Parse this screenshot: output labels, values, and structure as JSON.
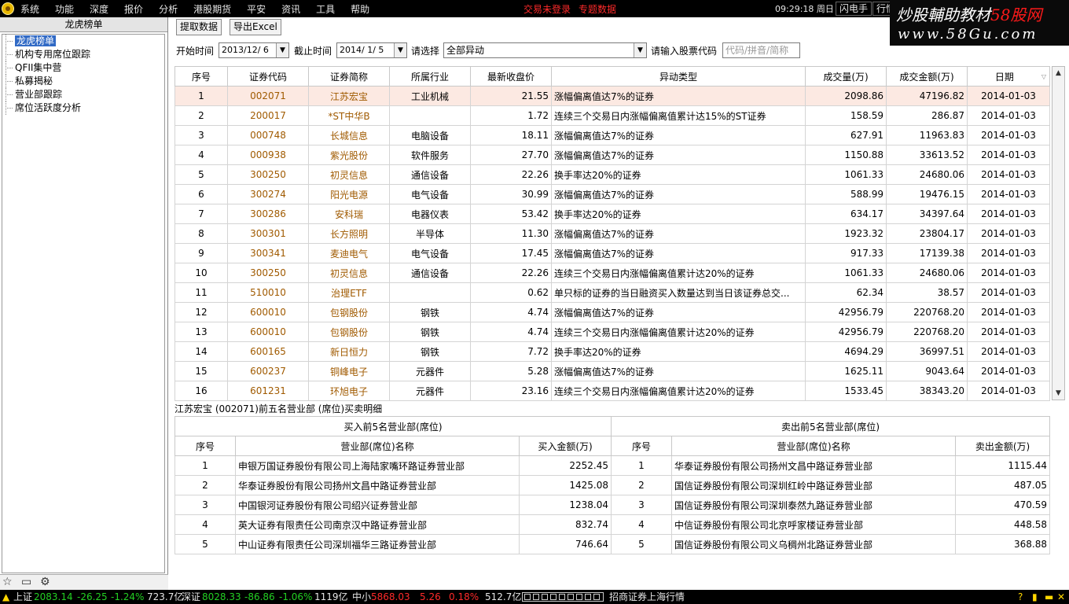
{
  "menu": {
    "items": [
      "系统",
      "功能",
      "深度",
      "报价",
      "分析",
      "港股期货",
      "平安",
      "资讯",
      "工具",
      "帮助"
    ],
    "notice1": "交易未登录",
    "notice2": "专题数据",
    "clock": "09:29:18",
    "day": "周日",
    "btn_flash": "闪电手",
    "btn_quote": "行情"
  },
  "watermark": {
    "line1a": "炒股輔助教材",
    "line1b": "58股网",
    "line2": "www.58Gu.com"
  },
  "left": {
    "title": "龙虎榜单",
    "items": [
      "龙虎榜单",
      "机构专用席位跟踪",
      "QFII集中营",
      "私募揭秘",
      "营业部跟踪",
      "席位活跃度分析"
    ],
    "icons": [
      "star-icon",
      "folder-icon",
      "gear-icon"
    ]
  },
  "toolbar": {
    "fetch": "提取数据",
    "export": "导出Excel"
  },
  "filter": {
    "start_label": "开始时间",
    "start_value": "2013/12/ 6",
    "end_label": "截止时间",
    "end_value": "2014/ 1/ 5",
    "choose_label": "请选择",
    "choose_value": "全部异动",
    "code_label": "请输入股票代码",
    "code_placeholder": "代码/拼音/简称"
  },
  "table": {
    "headers": [
      "序号",
      "证券代码",
      "证券简称",
      "所属行业",
      "最新收盘价",
      "异动类型",
      "成交量(万)",
      "成交金额(万)",
      "日期"
    ],
    "rows": [
      [
        "1",
        "002071",
        "江苏宏宝",
        "工业机械",
        "21.55",
        "涨幅偏离值达7%的证券",
        "2098.86",
        "47196.82",
        "2014-01-03"
      ],
      [
        "2",
        "200017",
        "*ST中华B",
        "",
        "1.72",
        "连续三个交易日内涨幅偏离值累计达15%的ST证券",
        "158.59",
        "286.87",
        "2014-01-03"
      ],
      [
        "3",
        "000748",
        "长城信息",
        "电脑设备",
        "18.11",
        "涨幅偏离值达7%的证券",
        "627.91",
        "11963.83",
        "2014-01-03"
      ],
      [
        "4",
        "000938",
        "紫光股份",
        "软件服务",
        "27.70",
        "涨幅偏离值达7%的证券",
        "1150.88",
        "33613.52",
        "2014-01-03"
      ],
      [
        "5",
        "300250",
        "初灵信息",
        "通信设备",
        "22.26",
        "换手率达20%的证券",
        "1061.33",
        "24680.06",
        "2014-01-03"
      ],
      [
        "6",
        "300274",
        "阳光电源",
        "电气设备",
        "30.99",
        "涨幅偏离值达7%的证券",
        "588.99",
        "19476.15",
        "2014-01-03"
      ],
      [
        "7",
        "300286",
        "安科瑞",
        "电器仪表",
        "53.42",
        "换手率达20%的证券",
        "634.17",
        "34397.64",
        "2014-01-03"
      ],
      [
        "8",
        "300301",
        "长方照明",
        "半导体",
        "11.30",
        "涨幅偏离值达7%的证券",
        "1923.32",
        "23804.17",
        "2014-01-03"
      ],
      [
        "9",
        "300341",
        "麦迪电气",
        "电气设备",
        "17.45",
        "涨幅偏离值达7%的证券",
        "917.33",
        "17139.38",
        "2014-01-03"
      ],
      [
        "10",
        "300250",
        "初灵信息",
        "通信设备",
        "22.26",
        "连续三个交易日内涨幅偏离值累计达20%的证券",
        "1061.33",
        "24680.06",
        "2014-01-03"
      ],
      [
        "11",
        "510010",
        "治理ETF",
        "",
        "0.62",
        "单只标的证券的当日融资买入数量达到当日该证券总交...",
        "62.34",
        "38.57",
        "2014-01-03"
      ],
      [
        "12",
        "600010",
        "包钢股份",
        "钢铁",
        "4.74",
        "涨幅偏离值达7%的证券",
        "42956.79",
        "220768.20",
        "2014-01-03"
      ],
      [
        "13",
        "600010",
        "包钢股份",
        "钢铁",
        "4.74",
        "连续三个交易日内涨幅偏离值累计达20%的证券",
        "42956.79",
        "220768.20",
        "2014-01-03"
      ],
      [
        "14",
        "600165",
        "新日恒力",
        "钢铁",
        "7.72",
        "换手率达20%的证券",
        "4694.29",
        "36997.51",
        "2014-01-03"
      ],
      [
        "15",
        "600237",
        "铜峰电子",
        "元器件",
        "5.28",
        "涨幅偏离值达7%的证券",
        "1625.11",
        "9043.64",
        "2014-01-03"
      ],
      [
        "16",
        "601231",
        "环旭电子",
        "元器件",
        "23.16",
        "连续三个交易日内涨幅偏离值累计达20%的证券",
        "1533.45",
        "38343.20",
        "2014-01-03"
      ]
    ]
  },
  "detail": {
    "title": "江苏宏宝 (002071)前五名营业部 (席位)买卖明细",
    "buy_group": "买入前5名营业部(席位)",
    "sell_group": "卖出前5名营业部(席位)",
    "headers": [
      "序号",
      "营业部(席位)名称",
      "买入金额(万)",
      "序号",
      "营业部(席位)名称",
      "卖出金额(万)"
    ],
    "rows": [
      [
        "1",
        "申银万国证券股份有限公司上海陆家嘴环路证券营业部",
        "2252.45",
        "1",
        "华泰证券股份有限公司扬州文昌中路证券营业部",
        "1115.44"
      ],
      [
        "2",
        "华泰证券股份有限公司扬州文昌中路证券营业部",
        "1425.08",
        "2",
        "国信证券股份有限公司深圳红岭中路证券营业部",
        "487.05"
      ],
      [
        "3",
        "中国银河证券股份有限公司绍兴证券营业部",
        "1238.04",
        "3",
        "国信证券股份有限公司深圳泰然九路证券营业部",
        "470.59"
      ],
      [
        "4",
        "英大证券有限责任公司南京汉中路证券营业部",
        "832.74",
        "4",
        "中信证券股份有限公司北京呼家楼证券营业部",
        "448.58"
      ],
      [
        "5",
        "中山证券有限责任公司深圳福华三路证券营业部",
        "746.64",
        "5",
        "国信证券股份有限公司义乌稠州北路证券营业部",
        "368.88"
      ]
    ]
  },
  "status": {
    "sh_label": "上证",
    "sh_index": "2083.14",
    "sh_change": "-26.25",
    "sh_pct": "-1.24%",
    "sh_amount": "723.7亿",
    "sz_label": "深证",
    "sz_index": "8028.33",
    "sz_change": "-86.86",
    "sz_pct": "-1.06%",
    "sz_amount": "1119亿",
    "zx_label": "中小",
    "zx_index": "5868.03",
    "zx_change": "5.26",
    "zx_pct": "0.18%",
    "zx_amount": "512.7亿",
    "broker": "招商证券上海行情"
  }
}
